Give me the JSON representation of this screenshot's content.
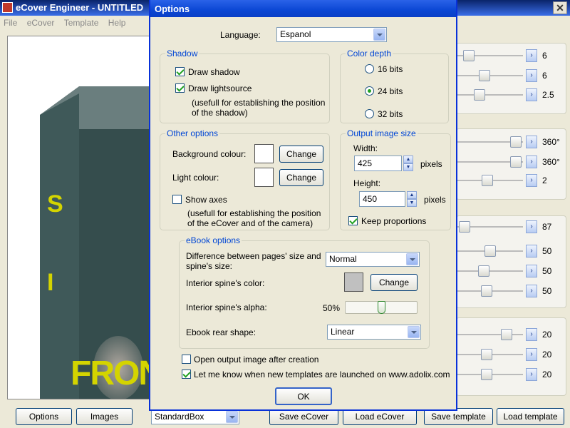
{
  "main": {
    "title": "eCover Engineer - UNTITLED",
    "menu": [
      "File",
      "eCover",
      "Template",
      "Help"
    ],
    "preview": {
      "spine_text": "S I",
      "front_text": "FRONT"
    },
    "right_rows": [
      {
        "value": "6",
        "level": 0.1
      },
      {
        "value": "6",
        "level": 0.4
      },
      {
        "value": "2.5",
        "level": 0.3
      },
      {
        "value": "360°",
        "level": 0.98
      },
      {
        "value": "360°",
        "level": 0.98
      },
      {
        "value": "2",
        "level": 0.45
      },
      {
        "value": "87",
        "level": 0.02
      },
      {
        "value": "50",
        "level": 0.5
      },
      {
        "value": "50",
        "level": 0.38
      },
      {
        "value": "50",
        "level": 0.43
      },
      {
        "value": "20",
        "level": 0.8
      },
      {
        "value": "20",
        "level": 0.44
      },
      {
        "value": "20",
        "level": 0.44
      }
    ],
    "bottom": {
      "options_label": "Options",
      "images_label": "Images",
      "template_combo": "StandardBox",
      "save_ecover_label": "Save eCover",
      "load_ecover_label": "Load eCover",
      "save_template_label": "Save template",
      "load_template_label": "Load template"
    }
  },
  "dialog": {
    "title": "Options",
    "language_label": "Language:",
    "language_value": "Espanol",
    "shadow": {
      "group_label": "Shadow",
      "draw_shadow": {
        "label": "Draw shadow",
        "checked": true
      },
      "draw_lightsource": {
        "label": "Draw lightsource",
        "checked": true
      },
      "note_line1": "(usefull  for establishing the position",
      "note_line2": "of the shadow)"
    },
    "color_depth": {
      "group_label": "Color depth",
      "options": [
        {
          "label": "16 bits",
          "checked": false
        },
        {
          "label": "24 bits",
          "checked": true
        },
        {
          "label": "32 bits",
          "checked": false
        }
      ]
    },
    "other": {
      "group_label": "Other options",
      "bg_colour_label": "Background colour:",
      "bg_colour": "#ffffff",
      "light_colour_label": "Light colour:",
      "light_colour": "#ffffff",
      "change_label": "Change",
      "show_axes": {
        "label": "Show axes",
        "checked": false
      },
      "note_line1": "(usefull  for establishing the position",
      "note_line2": "of the eCover and of the camera)"
    },
    "output": {
      "group_label": "Output image size",
      "width_label": "Width:",
      "width_value": "425",
      "height_label": "Height:",
      "height_value": "450",
      "unit": "pixels",
      "keep_proportions": {
        "label": "Keep proportions",
        "checked": true
      }
    },
    "ebook": {
      "group_label": "eBook options",
      "diff_label_line1": "Difference between pages' size and",
      "diff_label_line2": "spine's size:",
      "diff_value": "Normal",
      "spine_color_label": "Interior spine's color:",
      "spine_color": "#c0c0c0",
      "change_label": "Change",
      "alpha_label": "Interior spine's alpha:",
      "alpha_value": "50%",
      "alpha_level": 0.5,
      "rear_label": "Ebook rear shape:",
      "rear_value": "Linear"
    },
    "open_after": {
      "label": "Open output image after creation",
      "checked": false
    },
    "notify": {
      "label": "Let me know when new templates are launched on www.adolix.com",
      "checked": true
    },
    "ok_label": "OK"
  }
}
